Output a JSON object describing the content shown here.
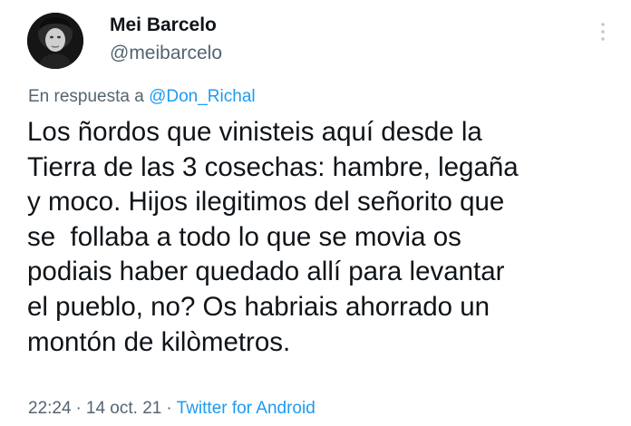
{
  "author": {
    "name": "Mei Barcelo",
    "handle": "@meibarcelo"
  },
  "reply": {
    "prefix": "En respuesta a ",
    "mention": "@Don_Richal"
  },
  "tweet": {
    "lines": [
      "Los ñordos que vinisteis aquí desde la",
      "Tierra de las 3 cosechas: hambre, legaña",
      "y moco. Hijos ilegitimos del señorito que",
      "se  follaba a todo lo que se movia os",
      "podiais haber quedado allí para levantar",
      "el pueblo, no? Os habriais ahorrado un",
      "montón de kilòmetros."
    ]
  },
  "meta": {
    "time": "22:24",
    "separator": "·",
    "date": "14 oct. 21",
    "source": "Twitter for Android"
  },
  "colors": {
    "text": "#0f1419",
    "secondary": "#536471",
    "link": "#1d9bf0",
    "background": "#ffffff"
  },
  "icons": {
    "more": "more-vertical-icon"
  }
}
